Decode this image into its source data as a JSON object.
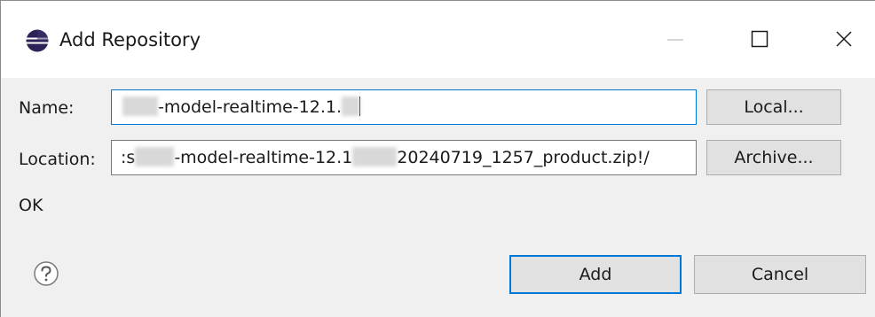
{
  "window": {
    "title": "Add Repository",
    "icon": "eclipse-icon",
    "controls": [
      "minimize-icon",
      "maximize-icon",
      "close-icon"
    ]
  },
  "form": {
    "name_label": "Name:",
    "name_value_suffix": "-model-realtime-12.1.",
    "location_label": "Location:",
    "location_value_prefix": ":s",
    "location_value_mid": "-model-realtime-12.1",
    "location_value_suffix": "20240719_1257_product.zip!/",
    "status": "OK"
  },
  "buttons": {
    "local": "Local...",
    "archive": "Archive...",
    "add": "Add",
    "cancel": "Cancel"
  },
  "footer": {
    "help_icon": "help-icon"
  },
  "colors": {
    "focus_accent": "#0078d7",
    "dialog_bg": "#f0f0f0",
    "button_bg": "#e1e1e1"
  }
}
